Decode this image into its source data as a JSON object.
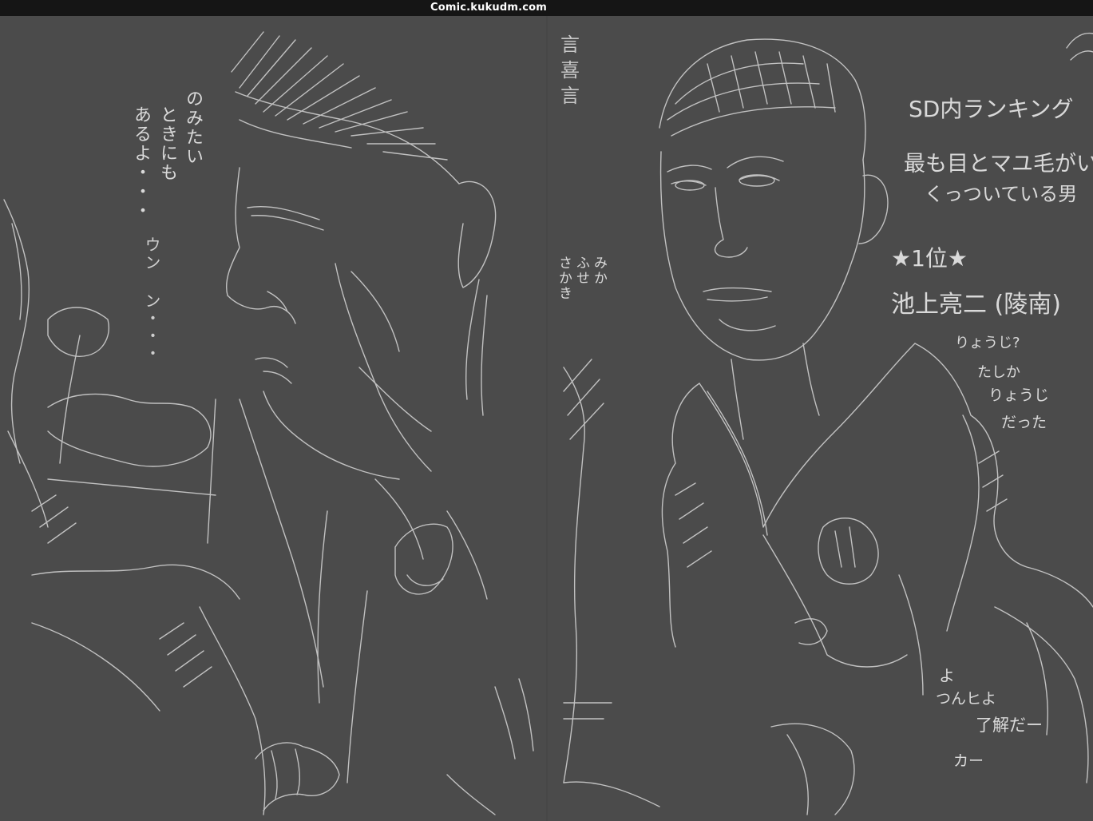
{
  "app": {
    "site_title": "Comic.kukudm.com",
    "background_color": "#4b4b4b",
    "topbar_color": "#151515",
    "sketch_color": "#d6d6d6"
  },
  "left_page": {
    "notes": {
      "col1": "のみたい",
      "col2": "ときにも",
      "col3": "あるよ・・・",
      "col4": "ウン ン・・・"
    }
  },
  "right_page": {
    "top_scribble": "言\n喜\n言",
    "side_note": {
      "col1": "みか",
      "col2": "ふせ",
      "col3": "さかき"
    },
    "ranking": {
      "heading": "SD内ランキング",
      "line1": "最も目とマユ毛がい",
      "line2": "くっついている男",
      "place": "★1位★",
      "name": "池上亮二 (陵南)",
      "comment1": "りょうじ?",
      "comment2": "たしか",
      "comment3": "りょうじ",
      "comment4": "だった"
    },
    "bottom_notes": {
      "line1": "よ",
      "line2": "つんヒよ",
      "line3": "了解だー",
      "line4": "カー"
    }
  }
}
